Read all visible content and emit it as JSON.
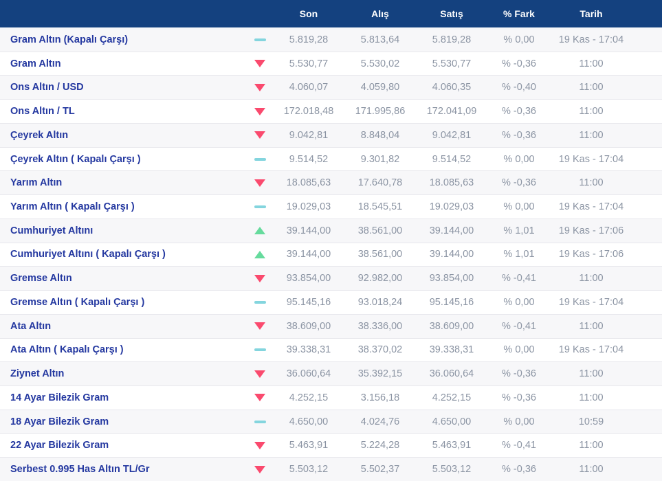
{
  "table": {
    "header": {
      "son": "Son",
      "alis": "Alış",
      "satis": "Satış",
      "fark": "% Fark",
      "tarih": "Tarih"
    },
    "rows": [
      {
        "name": "Gram Altın (Kapalı Çarşı)",
        "trend": "flat",
        "son": "5.819,28",
        "alis": "5.813,64",
        "satis": "5.819,28",
        "fark": "% 0,00",
        "tarih": "19 Kas - 17:04"
      },
      {
        "name": "Gram Altın",
        "trend": "down",
        "son": "5.530,77",
        "alis": "5.530,02",
        "satis": "5.530,77",
        "fark": "% -0,36",
        "tarih": "11:00"
      },
      {
        "name": "Ons Altın / USD",
        "trend": "down",
        "son": "4.060,07",
        "alis": "4.059,80",
        "satis": "4.060,35",
        "fark": "% -0,40",
        "tarih": "11:00"
      },
      {
        "name": "Ons Altın / TL",
        "trend": "down",
        "son": "172.018,48",
        "alis": "171.995,86",
        "satis": "172.041,09",
        "fark": "% -0,36",
        "tarih": "11:00"
      },
      {
        "name": "Çeyrek Altın",
        "trend": "down",
        "son": "9.042,81",
        "alis": "8.848,04",
        "satis": "9.042,81",
        "fark": "% -0,36",
        "tarih": "11:00"
      },
      {
        "name": "Çeyrek Altın ( Kapalı Çarşı )",
        "trend": "flat",
        "son": "9.514,52",
        "alis": "9.301,82",
        "satis": "9.514,52",
        "fark": "% 0,00",
        "tarih": "19 Kas - 17:04"
      },
      {
        "name": "Yarım Altın",
        "trend": "down",
        "son": "18.085,63",
        "alis": "17.640,78",
        "satis": "18.085,63",
        "fark": "% -0,36",
        "tarih": "11:00"
      },
      {
        "name": "Yarım Altın ( Kapalı Çarşı )",
        "trend": "flat",
        "son": "19.029,03",
        "alis": "18.545,51",
        "satis": "19.029,03",
        "fark": "% 0,00",
        "tarih": "19 Kas - 17:04"
      },
      {
        "name": "Cumhuriyet Altını",
        "trend": "up",
        "son": "39.144,00",
        "alis": "38.561,00",
        "satis": "39.144,00",
        "fark": "% 1,01",
        "tarih": "19 Kas - 17:06"
      },
      {
        "name": "Cumhuriyet Altını ( Kapalı Çarşı )",
        "trend": "up",
        "son": "39.144,00",
        "alis": "38.561,00",
        "satis": "39.144,00",
        "fark": "% 1,01",
        "tarih": "19 Kas - 17:06"
      },
      {
        "name": "Gremse Altın",
        "trend": "down",
        "son": "93.854,00",
        "alis": "92.982,00",
        "satis": "93.854,00",
        "fark": "% -0,41",
        "tarih": "11:00"
      },
      {
        "name": "Gremse Altın ( Kapalı Çarşı )",
        "trend": "flat",
        "son": "95.145,16",
        "alis": "93.018,24",
        "satis": "95.145,16",
        "fark": "% 0,00",
        "tarih": "19 Kas - 17:04"
      },
      {
        "name": "Ata Altın",
        "trend": "down",
        "son": "38.609,00",
        "alis": "38.336,00",
        "satis": "38.609,00",
        "fark": "% -0,41",
        "tarih": "11:00"
      },
      {
        "name": "Ata Altın ( Kapalı Çarşı )",
        "trend": "flat",
        "son": "39.338,31",
        "alis": "38.370,02",
        "satis": "39.338,31",
        "fark": "% 0,00",
        "tarih": "19 Kas - 17:04"
      },
      {
        "name": "Ziynet Altın",
        "trend": "down",
        "son": "36.060,64",
        "alis": "35.392,15",
        "satis": "36.060,64",
        "fark": "% -0,36",
        "tarih": "11:00"
      },
      {
        "name": "14 Ayar Bilezik Gram",
        "trend": "down",
        "son": "4.252,15",
        "alis": "3.156,18",
        "satis": "4.252,15",
        "fark": "% -0,36",
        "tarih": "11:00"
      },
      {
        "name": "18 Ayar Bilezik Gram",
        "trend": "flat",
        "son": "4.650,00",
        "alis": "4.024,76",
        "satis": "4.650,00",
        "fark": "% 0,00",
        "tarih": "10:59"
      },
      {
        "name": "22 Ayar Bilezik Gram",
        "trend": "down",
        "son": "5.463,91",
        "alis": "5.224,28",
        "satis": "5.463,91",
        "fark": "% -0,41",
        "tarih": "11:00"
      },
      {
        "name": "Serbest 0.995 Has Altın TL/Gr",
        "trend": "down",
        "son": "5.503,12",
        "alis": "5.502,37",
        "satis": "5.503,12",
        "fark": "% -0,36",
        "tarih": "11:00"
      }
    ]
  },
  "colors": {
    "header_bg": "#14417f",
    "name_text": "#2438a0",
    "value_text": "#8b94a3",
    "trend_down": "#fa4a6e",
    "trend_up": "#66db9d",
    "trend_flat": "#84d5de",
    "row_stripe": "#f7f7f9"
  }
}
